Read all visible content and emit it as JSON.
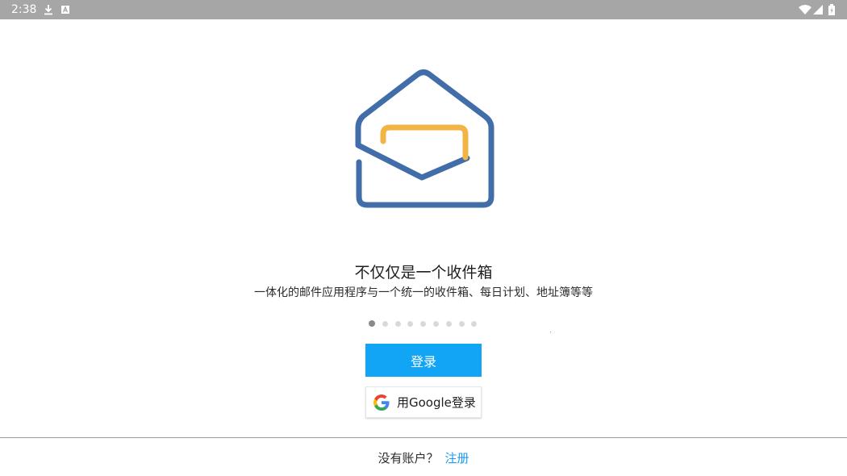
{
  "status_bar": {
    "time": "2:38",
    "icons": [
      "download-icon",
      "a-icon",
      "wifi-icon",
      "signal-icon",
      "battery-icon"
    ]
  },
  "logo": {
    "name": "mail-envelope-logo",
    "colors": {
      "envelope": "#416ea9",
      "card": "#f1b445"
    }
  },
  "onboarding": {
    "headline": "不仅仅是一个收件箱",
    "subline": "一体化的邮件应用程序与一个统一的收件箱、每日计划、地址簿等等",
    "page_indicator": {
      "total": 9,
      "active": 1
    }
  },
  "buttons": {
    "login_label": "登录",
    "google_login_label": "用Google登录"
  },
  "footer": {
    "no_account_text": "没有账户？",
    "register_link": "注册"
  },
  "colors": {
    "status_bar_bg": "#a6a6a6",
    "primary_button": "#13a5f5",
    "link": "#1a9af0"
  }
}
